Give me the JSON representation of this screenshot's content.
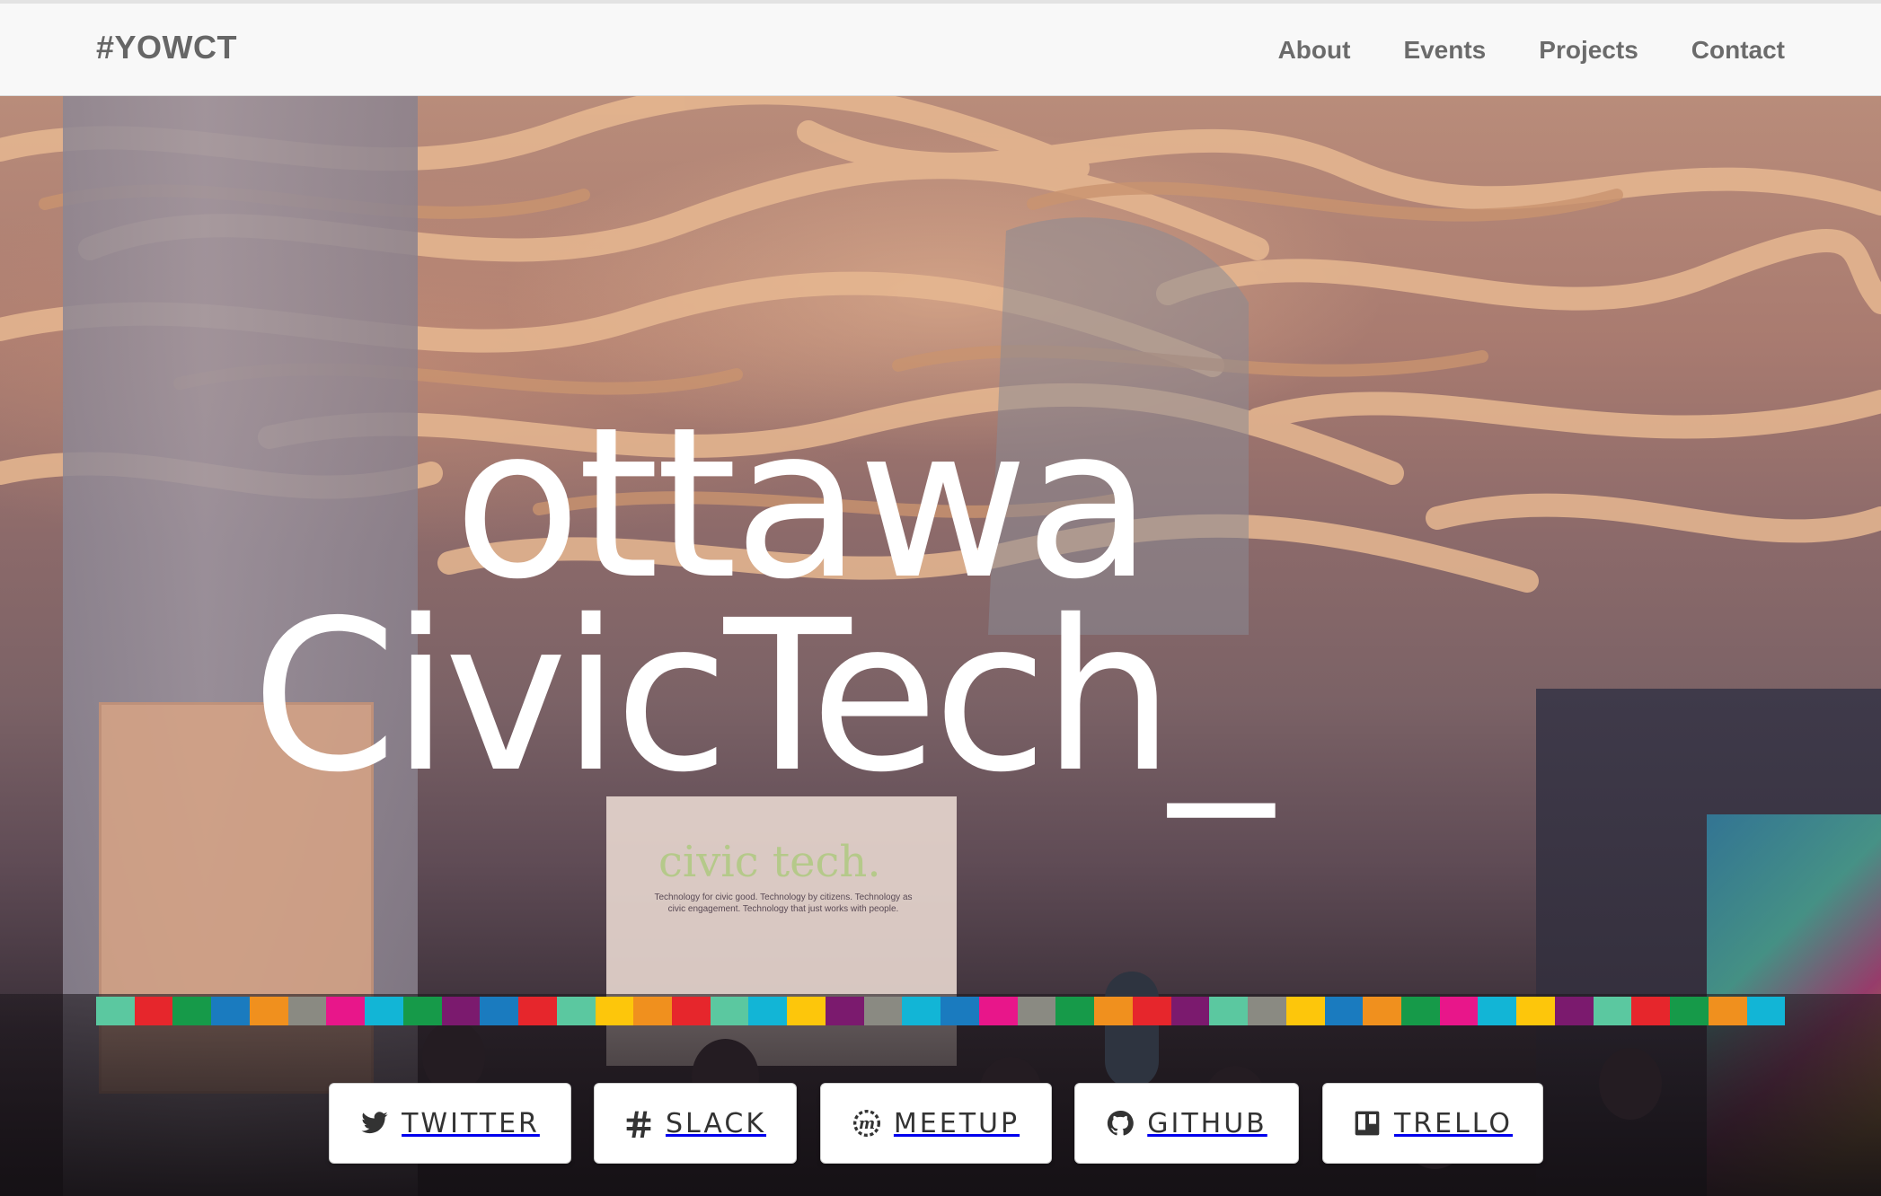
{
  "nav": {
    "brand": "#YOWCT",
    "links": [
      "About",
      "Events",
      "Projects",
      "Contact"
    ]
  },
  "hero": {
    "title_line1": "ottawa",
    "title_line2": "CivicTech_",
    "screen_title": "civic tech.",
    "screen_subtitle": "Technology for civic good. Technology by citizens. Technology as civic engagement. Technology that just works with people."
  },
  "color_strip": [
    "#5bc8a0",
    "#e6262c",
    "#169a49",
    "#1a7bbf",
    "#f0901e",
    "#8a8a82",
    "#e8168a",
    "#12b5d6",
    "#169a49",
    "#7b1a6e",
    "#1a7bbf",
    "#e6262c",
    "#5bc8a0",
    "#fdc60b",
    "#f0901e",
    "#e6262c",
    "#5bc8a0",
    "#12b5d6",
    "#fdc60b",
    "#7b1a6e",
    "#8a8a82",
    "#12b5d6",
    "#1a7bbf",
    "#e8168a",
    "#8a8a82",
    "#169a49",
    "#f0901e",
    "#e6262c",
    "#7b1a6e",
    "#5bc8a0",
    "#8a8a82",
    "#fdc60b",
    "#1a7bbf",
    "#f0901e",
    "#169a49",
    "#e8168a",
    "#12b5d6",
    "#fdc60b",
    "#7b1a6e",
    "#5bc8a0",
    "#e6262c",
    "#169a49",
    "#f0901e",
    "#12b5d6"
  ],
  "social": [
    {
      "label": "TWITTER",
      "icon": "twitter-icon"
    },
    {
      "label": "SLACK",
      "icon": "slack-icon"
    },
    {
      "label": "MEETUP",
      "icon": "meetup-icon"
    },
    {
      "label": "GITHUB",
      "icon": "github-icon"
    },
    {
      "label": "TRELLO",
      "icon": "trello-icon"
    }
  ]
}
